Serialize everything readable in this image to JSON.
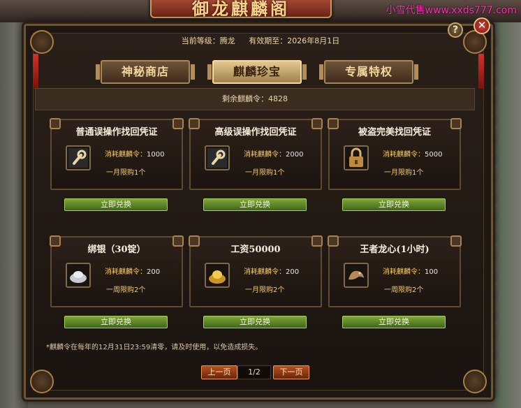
{
  "scene": {
    "title": "御龙麒麟阁",
    "watermark": "小雪代售www.xxds777.com"
  },
  "window": {
    "help": "?",
    "close": "✕",
    "level_label": "当前等级：腾龙",
    "expiry_label": "有效期至：2026年8月1日"
  },
  "tabs": [
    "神秘商店",
    "麒麟珍宝",
    "专属特权"
  ],
  "remaining": "剩余麒麟令：4828",
  "cost_prefix": "消耗麒麟令：",
  "redeem_label": "立即兑换",
  "items": [
    {
      "title": "普通误操作找回凭证",
      "cost": "1000",
      "limit": "一月限购1个",
      "icon": "wrench-icon"
    },
    {
      "title": "高级误操作找回凭证",
      "cost": "2000",
      "limit": "一月限购1个",
      "icon": "wrench-icon"
    },
    {
      "title": "被盗完美找回凭证",
      "cost": "5000",
      "limit": "一月限购1个",
      "icon": "lock-icon"
    },
    {
      "title": "绑银（30锭）",
      "cost": "200",
      "limit": "一周限购2个",
      "icon": "silver-ingot-icon"
    },
    {
      "title": "工资50000",
      "cost": "200",
      "limit": "一月限购2个",
      "icon": "gold-ingot-icon"
    },
    {
      "title": "王者龙心(1小时)",
      "cost": "100",
      "limit": "一周限购2个",
      "icon": "dragon-icon"
    }
  ],
  "footnote": "*麒麟令在每年的12月31日23:59清零，请及时使用，以免造成损失。",
  "pagination": {
    "prev": "上一页",
    "page": "1/2",
    "next": "下一页"
  },
  "colors": {
    "accent_gold": "#f2c96b",
    "button_green": "#5a8a28",
    "page_button": "#9a3e14"
  }
}
